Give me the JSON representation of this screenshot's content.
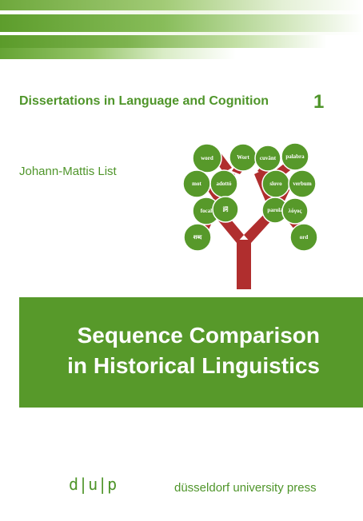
{
  "colors": {
    "brand_green": "#57992a",
    "text_green": "#4f952a",
    "trunk_red": "#b02e2e"
  },
  "series": {
    "title": "Dissertations in Language and Cognition",
    "number": "1"
  },
  "author": "Johann-Mattis List",
  "tree_words": {
    "word": "word",
    "wort": "Wort",
    "cuvant": "cuvânt",
    "palabra": "palabra",
    "mot": "mot",
    "adotto": "adottó",
    "slovo": "slovo",
    "verbum": "verbum",
    "focal": "focal",
    "ci": "詞",
    "parola": "parola",
    "logos": "λόγος",
    "devanagari": "शब्द",
    "ord": "ord"
  },
  "title": {
    "line1": "Sequence Comparison",
    "line2": "in Historical Linguistics"
  },
  "publisher": {
    "logo": "d|u|p",
    "name": "düsseldorf university press"
  }
}
